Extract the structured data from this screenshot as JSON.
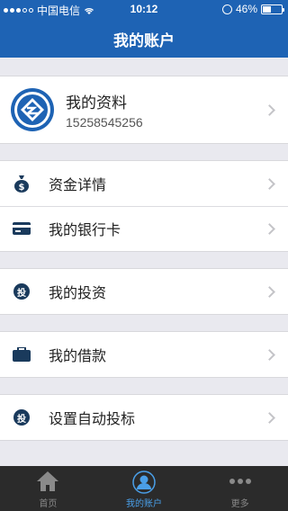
{
  "status_bar": {
    "carrier": "中国电信",
    "time": "10:12",
    "battery": "46%"
  },
  "header": {
    "title": "我的账户"
  },
  "profile": {
    "name": "我的资料",
    "phone": "15258545256"
  },
  "menu": {
    "fund_details": "资金详情",
    "bank_card": "我的银行卡",
    "investment": "我的投资",
    "investment_badge": "投",
    "loan": "我的借款",
    "auto_bid": "设置自动投标",
    "auto_bid_badge": "投"
  },
  "tabs": [
    {
      "label": "首页"
    },
    {
      "label": "我的账户"
    },
    {
      "label": "更多"
    }
  ],
  "colors": {
    "header": "#1e63b4",
    "background": "#e9e9ef",
    "tab_active": "#4a9fe8",
    "tabbar": "#2b2b2b"
  }
}
